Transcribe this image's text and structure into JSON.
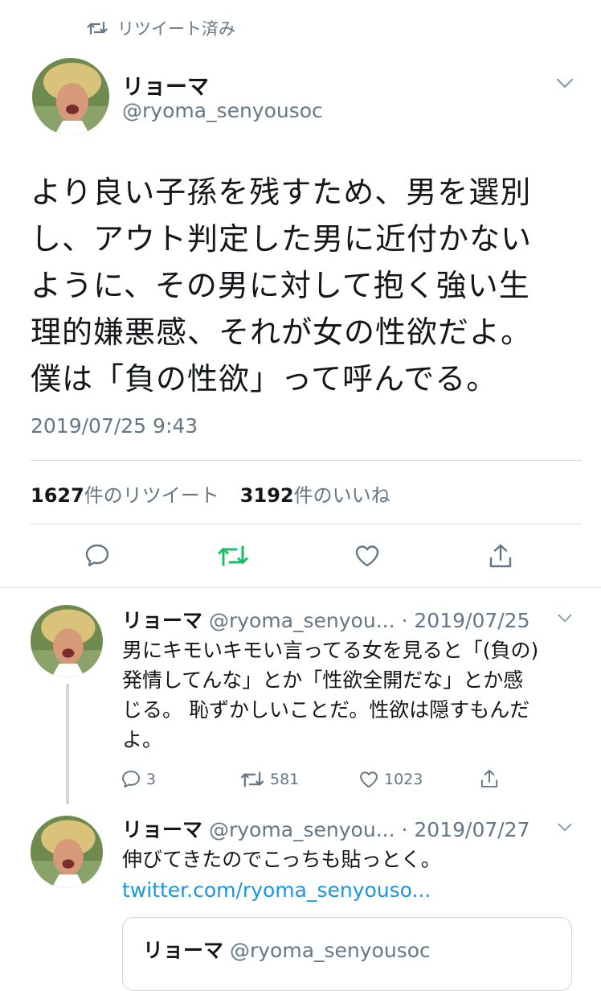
{
  "retweet_label": "リツイート済み",
  "main_tweet": {
    "name": "リョーマ",
    "handle": "@ryoma_senyousoc",
    "text": "より良い子孫を残すため、男を選別\nし、アウト判定した男に近付かない\nように、その男に対して抱く強い生\n理的嫌悪感、それが女の性欲だよ。\n僕は「負の性欲」って呼んでる。",
    "timestamp": "2019/07/25 9:43",
    "retweet_count": "1627",
    "retweet_suffix": "件のリツイート",
    "like_count": "3192",
    "like_suffix": "件のいいね"
  },
  "replies": [
    {
      "name": "リョーマ",
      "handle": "@ryoma_senyou...",
      "date": "· 2019/07/25",
      "text": "男にキモいキモい言ってる女を見ると「(負の)\n発情してんな」とか「性欲全開だな」とか感\nじる。 恥ずかしいことだ。性欲は隠すもんだ\nよ。",
      "reply_count": "3",
      "retweet_count": "581",
      "like_count": "1023"
    },
    {
      "name": "リョーマ",
      "handle": "@ryoma_senyou...",
      "date": "· 2019/07/27",
      "text": "伸びてきたのでこっちも貼っとく。",
      "link": "twitter.com/ryoma_senyouso..."
    }
  ],
  "quoted": {
    "name": "リョーマ",
    "handle": "@ryoma_senyousoc"
  },
  "icons": [
    "retweet-icon",
    "chevron-down-icon",
    "reply-icon",
    "like-icon",
    "share-icon"
  ],
  "colors": {
    "text": "#14171a",
    "muted": "#657786",
    "retweet_active": "#17bf63",
    "link": "#1b95e0",
    "divider": "#d9dfe3"
  }
}
